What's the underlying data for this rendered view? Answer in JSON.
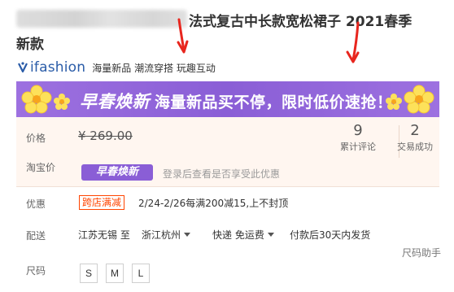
{
  "title": {
    "part1": "法式复古中长款宽松裙子 2021春季",
    "part2": "新款"
  },
  "brand": {
    "logo_text": "ifashion",
    "tags": "海量新品 潮流穿搭 玩趣互动"
  },
  "banner": {
    "headline": "早春焕新",
    "text": "海量新品买不停，限时低价速抢！"
  },
  "price": {
    "label": "价格",
    "original": "¥ 269.00"
  },
  "stats": {
    "reviews_count": "9",
    "reviews_label": "累计评论",
    "sales_count": "2",
    "sales_label": "交易成功"
  },
  "taobao_price": {
    "label": "淘宝价",
    "badge": "早春焕新",
    "note": "登录后查看是否享受此优惠"
  },
  "discount": {
    "label": "优惠",
    "badge": "跨店满减",
    "text": "2/24-2/26每满200减15,上不封顶"
  },
  "shipping": {
    "label": "配送",
    "from": "江苏无锡 至",
    "to": "浙江杭州",
    "method": "快递 免运费",
    "dispatch": "付款后30天内发货"
  },
  "size": {
    "helper": "尺码助手",
    "label": "尺码",
    "options": [
      "S",
      "M",
      "L"
    ]
  },
  "colors": {
    "accent_purple": "#8a5ed6",
    "discount_orange": "#ff4400",
    "annotation_red": "#e8261e",
    "brand_blue": "#2a5ca8"
  }
}
